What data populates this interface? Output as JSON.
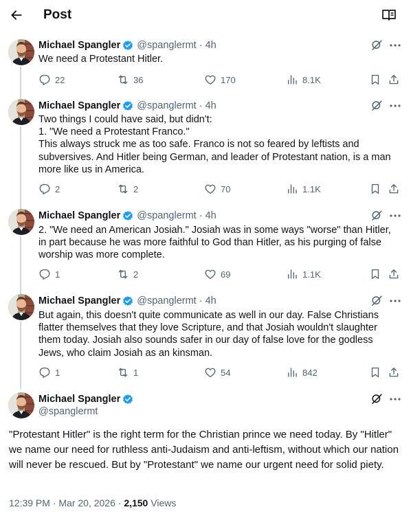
{
  "header": {
    "title": "Post"
  },
  "author": {
    "display_name": "Michael Spangler",
    "handle": "@spanglermt",
    "verified_color": "#1d9bf0"
  },
  "tweets": [
    {
      "time": "4h",
      "text": "We need a Protestant Hitler.",
      "replies": "22",
      "reposts": "36",
      "likes": "170",
      "views": "8.1K"
    },
    {
      "time": "4h",
      "text": "Two things I could have said, but didn't:\n1. \"We need a Protestant Franco.\"\nThis always struck me as too safe. Franco is not so feared by leftists and subversives. And Hitler being German, and leader of Protestant nation, is a man more like us in America.",
      "replies": "2",
      "reposts": "2",
      "likes": "70",
      "views": "1.1K"
    },
    {
      "time": "4h",
      "text": "2. \"We need an American Josiah.\" Josiah was in some ways \"worse\" than Hitler, in part because he was more faithful to God than Hitler, as his purging of false worship was more complete.",
      "replies": "1",
      "reposts": "2",
      "likes": "69",
      "views": "1.1K"
    },
    {
      "time": "4h",
      "text": "But again, this doesn't quite communicate as well in our day. False Christians flatter themselves that they love Scripture, and that Josiah wouldn't slaughter them today. Josiah also sounds safer in our day of false love for the godless Jews, who claim Josiah as an kinsman.",
      "replies": "1",
      "reposts": "1",
      "likes": "54",
      "views": "842"
    }
  ],
  "main_post": {
    "text": "\"Protestant Hitler\" is the right term for the Christian prince we need today. By \"Hitler\" we name our need for ruthless anti-Judaism and anti-leftism, without which our nation will never be rescued. But by \"Protestant\" we name our urgent need for solid piety.",
    "timestamp": "12:39 PM · Mar 20, 2026 · ",
    "views_count": "2,150",
    "views_label": " Views"
  },
  "icons": {
    "back": "arrow-left-icon",
    "reader": "reader-mode-icon",
    "grok": "grok-icon",
    "more": "more-icon",
    "reply": "reply-icon",
    "repost": "repost-icon",
    "like": "heart-icon",
    "views": "analytics-icon",
    "bookmark": "bookmark-icon",
    "share": "share-icon"
  }
}
